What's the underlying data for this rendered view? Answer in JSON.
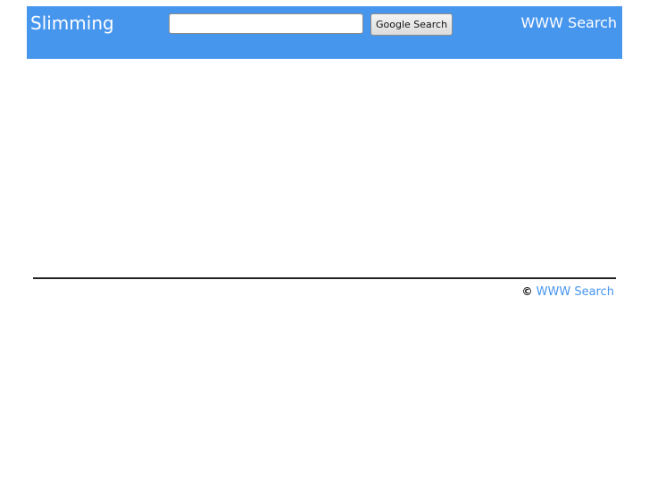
{
  "header": {
    "brand": "Slimming",
    "search_placeholder": "",
    "search_value": "",
    "search_button_label": "Google Search",
    "right_link": "WWW Search",
    "background_color": "#4796ee"
  },
  "footer": {
    "copyright_symbol": "©",
    "link_text": "WWW Search",
    "link_color": "#4796ee"
  }
}
